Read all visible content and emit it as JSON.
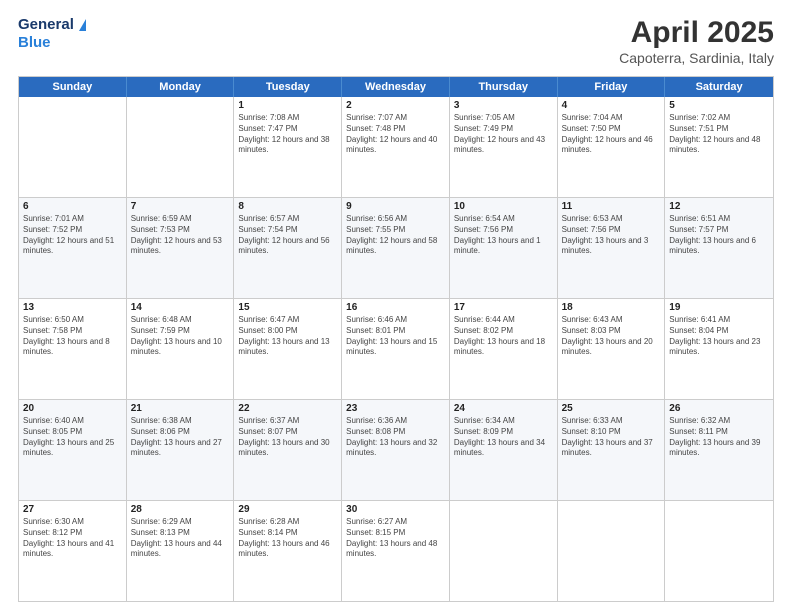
{
  "header": {
    "logo_general": "General",
    "logo_blue": "Blue",
    "title": "April 2025",
    "location": "Capoterra, Sardinia, Italy"
  },
  "weekdays": [
    "Sunday",
    "Monday",
    "Tuesday",
    "Wednesday",
    "Thursday",
    "Friday",
    "Saturday"
  ],
  "rows": [
    [
      {
        "day": "",
        "text": ""
      },
      {
        "day": "",
        "text": ""
      },
      {
        "day": "1",
        "text": "Sunrise: 7:08 AM\nSunset: 7:47 PM\nDaylight: 12 hours and 38 minutes."
      },
      {
        "day": "2",
        "text": "Sunrise: 7:07 AM\nSunset: 7:48 PM\nDaylight: 12 hours and 40 minutes."
      },
      {
        "day": "3",
        "text": "Sunrise: 7:05 AM\nSunset: 7:49 PM\nDaylight: 12 hours and 43 minutes."
      },
      {
        "day": "4",
        "text": "Sunrise: 7:04 AM\nSunset: 7:50 PM\nDaylight: 12 hours and 46 minutes."
      },
      {
        "day": "5",
        "text": "Sunrise: 7:02 AM\nSunset: 7:51 PM\nDaylight: 12 hours and 48 minutes."
      }
    ],
    [
      {
        "day": "6",
        "text": "Sunrise: 7:01 AM\nSunset: 7:52 PM\nDaylight: 12 hours and 51 minutes."
      },
      {
        "day": "7",
        "text": "Sunrise: 6:59 AM\nSunset: 7:53 PM\nDaylight: 12 hours and 53 minutes."
      },
      {
        "day": "8",
        "text": "Sunrise: 6:57 AM\nSunset: 7:54 PM\nDaylight: 12 hours and 56 minutes."
      },
      {
        "day": "9",
        "text": "Sunrise: 6:56 AM\nSunset: 7:55 PM\nDaylight: 12 hours and 58 minutes."
      },
      {
        "day": "10",
        "text": "Sunrise: 6:54 AM\nSunset: 7:56 PM\nDaylight: 13 hours and 1 minute."
      },
      {
        "day": "11",
        "text": "Sunrise: 6:53 AM\nSunset: 7:56 PM\nDaylight: 13 hours and 3 minutes."
      },
      {
        "day": "12",
        "text": "Sunrise: 6:51 AM\nSunset: 7:57 PM\nDaylight: 13 hours and 6 minutes."
      }
    ],
    [
      {
        "day": "13",
        "text": "Sunrise: 6:50 AM\nSunset: 7:58 PM\nDaylight: 13 hours and 8 minutes."
      },
      {
        "day": "14",
        "text": "Sunrise: 6:48 AM\nSunset: 7:59 PM\nDaylight: 13 hours and 10 minutes."
      },
      {
        "day": "15",
        "text": "Sunrise: 6:47 AM\nSunset: 8:00 PM\nDaylight: 13 hours and 13 minutes."
      },
      {
        "day": "16",
        "text": "Sunrise: 6:46 AM\nSunset: 8:01 PM\nDaylight: 13 hours and 15 minutes."
      },
      {
        "day": "17",
        "text": "Sunrise: 6:44 AM\nSunset: 8:02 PM\nDaylight: 13 hours and 18 minutes."
      },
      {
        "day": "18",
        "text": "Sunrise: 6:43 AM\nSunset: 8:03 PM\nDaylight: 13 hours and 20 minutes."
      },
      {
        "day": "19",
        "text": "Sunrise: 6:41 AM\nSunset: 8:04 PM\nDaylight: 13 hours and 23 minutes."
      }
    ],
    [
      {
        "day": "20",
        "text": "Sunrise: 6:40 AM\nSunset: 8:05 PM\nDaylight: 13 hours and 25 minutes."
      },
      {
        "day": "21",
        "text": "Sunrise: 6:38 AM\nSunset: 8:06 PM\nDaylight: 13 hours and 27 minutes."
      },
      {
        "day": "22",
        "text": "Sunrise: 6:37 AM\nSunset: 8:07 PM\nDaylight: 13 hours and 30 minutes."
      },
      {
        "day": "23",
        "text": "Sunrise: 6:36 AM\nSunset: 8:08 PM\nDaylight: 13 hours and 32 minutes."
      },
      {
        "day": "24",
        "text": "Sunrise: 6:34 AM\nSunset: 8:09 PM\nDaylight: 13 hours and 34 minutes."
      },
      {
        "day": "25",
        "text": "Sunrise: 6:33 AM\nSunset: 8:10 PM\nDaylight: 13 hours and 37 minutes."
      },
      {
        "day": "26",
        "text": "Sunrise: 6:32 AM\nSunset: 8:11 PM\nDaylight: 13 hours and 39 minutes."
      }
    ],
    [
      {
        "day": "27",
        "text": "Sunrise: 6:30 AM\nSunset: 8:12 PM\nDaylight: 13 hours and 41 minutes."
      },
      {
        "day": "28",
        "text": "Sunrise: 6:29 AM\nSunset: 8:13 PM\nDaylight: 13 hours and 44 minutes."
      },
      {
        "day": "29",
        "text": "Sunrise: 6:28 AM\nSunset: 8:14 PM\nDaylight: 13 hours and 46 minutes."
      },
      {
        "day": "30",
        "text": "Sunrise: 6:27 AM\nSunset: 8:15 PM\nDaylight: 13 hours and 48 minutes."
      },
      {
        "day": "",
        "text": ""
      },
      {
        "day": "",
        "text": ""
      },
      {
        "day": "",
        "text": ""
      }
    ]
  ]
}
